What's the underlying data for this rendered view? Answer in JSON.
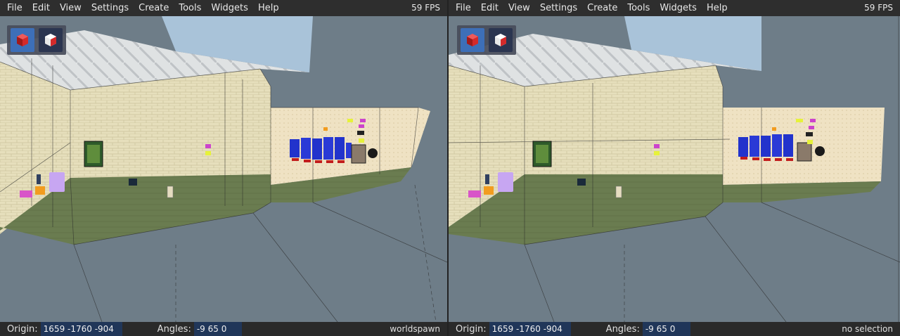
{
  "menu": [
    "File",
    "Edit",
    "View",
    "Settings",
    "Create",
    "Tools",
    "Widgets",
    "Help"
  ],
  "fps": "59 FPS",
  "toolbox": {
    "tools": [
      {
        "icon": "brush-tool-icon",
        "active": true
      },
      {
        "icon": "entity-tool-icon",
        "active": false
      }
    ]
  },
  "left": {
    "origin_label": "Origin:",
    "origin_value": "1659 -1760 -904",
    "angles_label": "Angles:",
    "angles_value": "-9 65 0",
    "status": "worldspawn"
  },
  "right": {
    "origin_label": "Origin:",
    "origin_value": "1659 -1760 -904",
    "angles_label": "Angles:",
    "angles_value": "-9 65 0",
    "status": "no selection"
  },
  "colors": {
    "menubar": "#2e2e2e",
    "statusbar": "#2a2a2a",
    "field": "#203659",
    "void": "#6e7d88",
    "wall": "#e7dfbd",
    "floor": "#6b7d52",
    "ceiling": "#d8dcde",
    "sky": "#a9c3d9"
  }
}
